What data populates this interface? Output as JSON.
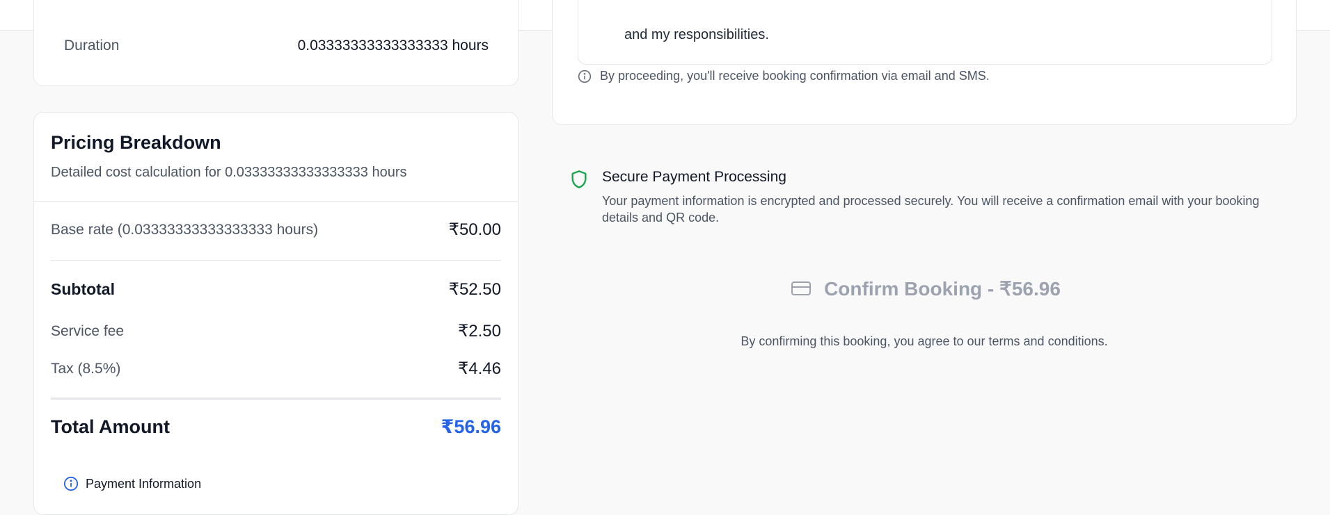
{
  "duration": {
    "label": "Duration",
    "value": "0.03333333333333333 hours"
  },
  "pricing": {
    "title": "Pricing Breakdown",
    "subtitle": "Detailed cost calculation for 0.03333333333333333 hours",
    "base_label": "Base rate (0.03333333333333333 hours)",
    "base_amount": "₹50.00",
    "subtotal_label": "Subtotal",
    "subtotal_amount": "₹52.50",
    "fee_label": "Service fee",
    "fee_amount": "₹2.50",
    "tax_label": "Tax (8.5%)",
    "tax_amount": "₹4.46",
    "total_label": "Total Amount",
    "total_amount": "₹56.96",
    "payment_info_label": "Payment Information"
  },
  "terms": {
    "text": "and my responsibilities.",
    "notice": "By proceeding, you'll receive booking confirmation via email and SMS."
  },
  "secure": {
    "title": "Secure Payment Processing",
    "description": "Your payment information is encrypted and processed securely. You will receive a confirmation email with your booking details and QR code."
  },
  "confirm": {
    "button_label": "Confirm Booking - ₹56.96",
    "agreement": "By confirming this booking, you agree to our terms and conditions."
  },
  "icons": {
    "menu": "menu-icon",
    "info": "info-icon",
    "shield": "shield-icon",
    "card": "credit-card-icon"
  },
  "colors": {
    "accent": "#2563eb",
    "secure_green": "#16a34a",
    "muted_button": "#9ca3af"
  }
}
